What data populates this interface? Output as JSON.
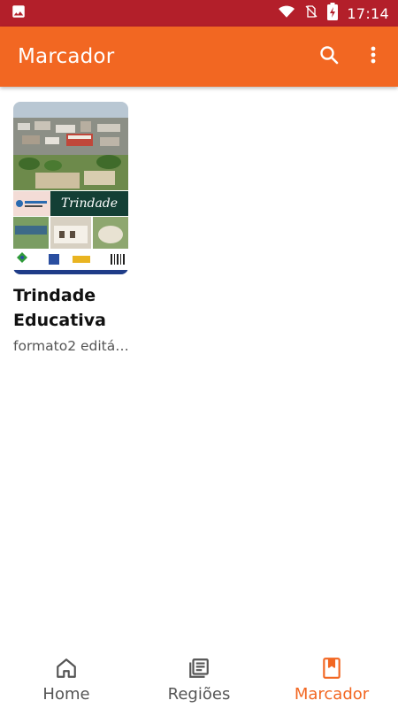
{
  "status_bar": {
    "time": "17:14",
    "icons": [
      "image-icon",
      "wifi-icon",
      "no-sim-icon",
      "battery-charging-icon"
    ]
  },
  "app_bar": {
    "title": "Marcador",
    "actions": [
      "search-icon",
      "more-vertical-icon"
    ]
  },
  "items": [
    {
      "title": "Trindade Educativa",
      "subtitle": "formato2 editável",
      "cover_text": "Trindade"
    }
  ],
  "bottom_nav": {
    "items": [
      {
        "label": "Home",
        "icon": "home-icon"
      },
      {
        "label": "Regiões",
        "icon": "news-icon"
      },
      {
        "label": "Marcador",
        "icon": "bookmark-icon"
      }
    ],
    "active_index": 2
  },
  "colors": {
    "status_bar": "#b31f2a",
    "app_bar": "#f26722",
    "accent": "#f26722",
    "inactive": "#555555"
  }
}
